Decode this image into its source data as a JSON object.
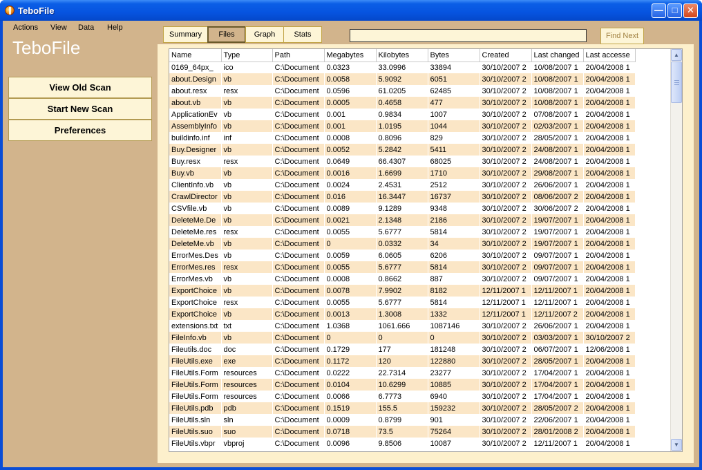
{
  "window": {
    "title": "TeboFile"
  },
  "menu": [
    "Actions",
    "View",
    "Data",
    "Help"
  ],
  "brand": "TeboFile",
  "sidebar": {
    "buttons": [
      "View Old Scan",
      "Start New Scan",
      "Preferences"
    ]
  },
  "tabs": [
    {
      "label": "Summary",
      "active": false
    },
    {
      "label": "Files",
      "active": true
    },
    {
      "label": "Graph",
      "active": false
    },
    {
      "label": "Stats",
      "active": false
    }
  ],
  "search": {
    "value": "",
    "find_next": "Find Next"
  },
  "table": {
    "columns": [
      "Name",
      "Type",
      "Path",
      "Megabytes",
      "Kilobytes",
      "Bytes",
      "Created",
      "Last changed",
      "Last accesse"
    ],
    "rows": [
      [
        "0169_64px_",
        "ico",
        "C:\\Document",
        "0.0323",
        "33.0996",
        "33894",
        "30/10/2007 2",
        "10/08/2007 1",
        "20/04/2008 1"
      ],
      [
        "about.Design",
        "vb",
        "C:\\Document",
        "0.0058",
        "5.9092",
        "6051",
        "30/10/2007 2",
        "10/08/2007 1",
        "20/04/2008 1"
      ],
      [
        "about.resx",
        "resx",
        "C:\\Document",
        "0.0596",
        "61.0205",
        "62485",
        "30/10/2007 2",
        "10/08/2007 1",
        "20/04/2008 1"
      ],
      [
        "about.vb",
        "vb",
        "C:\\Document",
        "0.0005",
        "0.4658",
        "477",
        "30/10/2007 2",
        "10/08/2007 1",
        "20/04/2008 1"
      ],
      [
        "ApplicationEv",
        "vb",
        "C:\\Document",
        "0.001",
        "0.9834",
        "1007",
        "30/10/2007 2",
        "07/08/2007 1",
        "20/04/2008 1"
      ],
      [
        "AssemblyInfo",
        "vb",
        "C:\\Document",
        "0.001",
        "1.0195",
        "1044",
        "30/10/2007 2",
        "02/03/2007 1",
        "20/04/2008 1"
      ],
      [
        "buildinfo.inf",
        "inf",
        "C:\\Document",
        "0.0008",
        "0.8096",
        "829",
        "30/10/2007 2",
        "28/05/2007 1",
        "20/04/2008 1"
      ],
      [
        "Buy.Designer",
        "vb",
        "C:\\Document",
        "0.0052",
        "5.2842",
        "5411",
        "30/10/2007 2",
        "24/08/2007 1",
        "20/04/2008 1"
      ],
      [
        "Buy.resx",
        "resx",
        "C:\\Document",
        "0.0649",
        "66.4307",
        "68025",
        "30/10/2007 2",
        "24/08/2007 1",
        "20/04/2008 1"
      ],
      [
        "Buy.vb",
        "vb",
        "C:\\Document",
        "0.0016",
        "1.6699",
        "1710",
        "30/10/2007 2",
        "29/08/2007 1",
        "20/04/2008 1"
      ],
      [
        "ClientInfo.vb",
        "vb",
        "C:\\Document",
        "0.0024",
        "2.4531",
        "2512",
        "30/10/2007 2",
        "26/06/2007 1",
        "20/04/2008 1"
      ],
      [
        "CrawlDirector",
        "vb",
        "C:\\Document",
        "0.016",
        "16.3447",
        "16737",
        "30/10/2007 2",
        "08/06/2007 2",
        "20/04/2008 1"
      ],
      [
        "CSVfile.vb",
        "vb",
        "C:\\Document",
        "0.0089",
        "9.1289",
        "9348",
        "30/10/2007 2",
        "30/06/2007 2",
        "20/04/2008 1"
      ],
      [
        "DeleteMe.De",
        "vb",
        "C:\\Document",
        "0.0021",
        "2.1348",
        "2186",
        "30/10/2007 2",
        "19/07/2007 1",
        "20/04/2008 1"
      ],
      [
        "DeleteMe.res",
        "resx",
        "C:\\Document",
        "0.0055",
        "5.6777",
        "5814",
        "30/10/2007 2",
        "19/07/2007 1",
        "20/04/2008 1"
      ],
      [
        "DeleteMe.vb",
        "vb",
        "C:\\Document",
        "0",
        "0.0332",
        "34",
        "30/10/2007 2",
        "19/07/2007 1",
        "20/04/2008 1"
      ],
      [
        "ErrorMes.Des",
        "vb",
        "C:\\Document",
        "0.0059",
        "6.0605",
        "6206",
        "30/10/2007 2",
        "09/07/2007 1",
        "20/04/2008 1"
      ],
      [
        "ErrorMes.res",
        "resx",
        "C:\\Document",
        "0.0055",
        "5.6777",
        "5814",
        "30/10/2007 2",
        "09/07/2007 1",
        "20/04/2008 1"
      ],
      [
        "ErrorMes.vb",
        "vb",
        "C:\\Document",
        "0.0008",
        "0.8662",
        "887",
        "30/10/2007 2",
        "09/07/2007 1",
        "20/04/2008 1"
      ],
      [
        "ExportChoice",
        "vb",
        "C:\\Document",
        "0.0078",
        "7.9902",
        "8182",
        "12/11/2007 1",
        "12/11/2007 1",
        "20/04/2008 1"
      ],
      [
        "ExportChoice",
        "resx",
        "C:\\Document",
        "0.0055",
        "5.6777",
        "5814",
        "12/11/2007 1",
        "12/11/2007 1",
        "20/04/2008 1"
      ],
      [
        "ExportChoice",
        "vb",
        "C:\\Document",
        "0.0013",
        "1.3008",
        "1332",
        "12/11/2007 1",
        "12/11/2007 2",
        "20/04/2008 1"
      ],
      [
        "extensions.txt",
        "txt",
        "C:\\Document",
        "1.0368",
        "1061.666",
        "1087146",
        "30/10/2007 2",
        "26/06/2007 1",
        "20/04/2008 1"
      ],
      [
        "FileInfo.vb",
        "vb",
        "C:\\Document",
        "0",
        "0",
        "0",
        "30/10/2007 2",
        "03/03/2007 1",
        "30/10/2007 2"
      ],
      [
        "Fileutils.doc",
        "doc",
        "C:\\Document",
        "0.1729",
        "177",
        "181248",
        "30/10/2007 2",
        "06/07/2007 1",
        "12/06/2008 1"
      ],
      [
        "FileUtils.exe",
        "exe",
        "C:\\Document",
        "0.1172",
        "120",
        "122880",
        "30/10/2007 2",
        "28/05/2007 1",
        "20/04/2008 1"
      ],
      [
        "FileUtils.Form",
        "resources",
        "C:\\Document",
        "0.0222",
        "22.7314",
        "23277",
        "30/10/2007 2",
        "17/04/2007 1",
        "20/04/2008 1"
      ],
      [
        "FileUtils.Form",
        "resources",
        "C:\\Document",
        "0.0104",
        "10.6299",
        "10885",
        "30/10/2007 2",
        "17/04/2007 1",
        "20/04/2008 1"
      ],
      [
        "FileUtils.Form",
        "resources",
        "C:\\Document",
        "0.0066",
        "6.7773",
        "6940",
        "30/10/2007 2",
        "17/04/2007 1",
        "20/04/2008 1"
      ],
      [
        "FileUtils.pdb",
        "pdb",
        "C:\\Document",
        "0.1519",
        "155.5",
        "159232",
        "30/10/2007 2",
        "28/05/2007 2",
        "20/04/2008 1"
      ],
      [
        "FileUtils.sln",
        "sln",
        "C:\\Document",
        "0.0009",
        "0.8799",
        "901",
        "30/10/2007 2",
        "22/06/2007 1",
        "20/04/2008 1"
      ],
      [
        "FileUtils.suo",
        "suo",
        "C:\\Document",
        "0.0718",
        "73.5",
        "75264",
        "30/10/2007 2",
        "28/01/2008 2",
        "20/04/2008 1"
      ],
      [
        "FileUtils.vbpr",
        "vbproj",
        "C:\\Document",
        "0.0096",
        "9.8506",
        "10087",
        "30/10/2007 2",
        "12/11/2007 1",
        "20/04/2008 1"
      ]
    ]
  },
  "colors": {
    "client": "#d2b48c",
    "panel": "#fdf0cc",
    "row_alt": "#fbe6c6",
    "titlebar": "#0654e0"
  },
  "icons": {
    "minimize": "minimize-icon",
    "maximize": "maximize-icon",
    "close": "close-icon",
    "scroll_up": "chevron-up-icon",
    "scroll_down": "chevron-down-icon"
  }
}
